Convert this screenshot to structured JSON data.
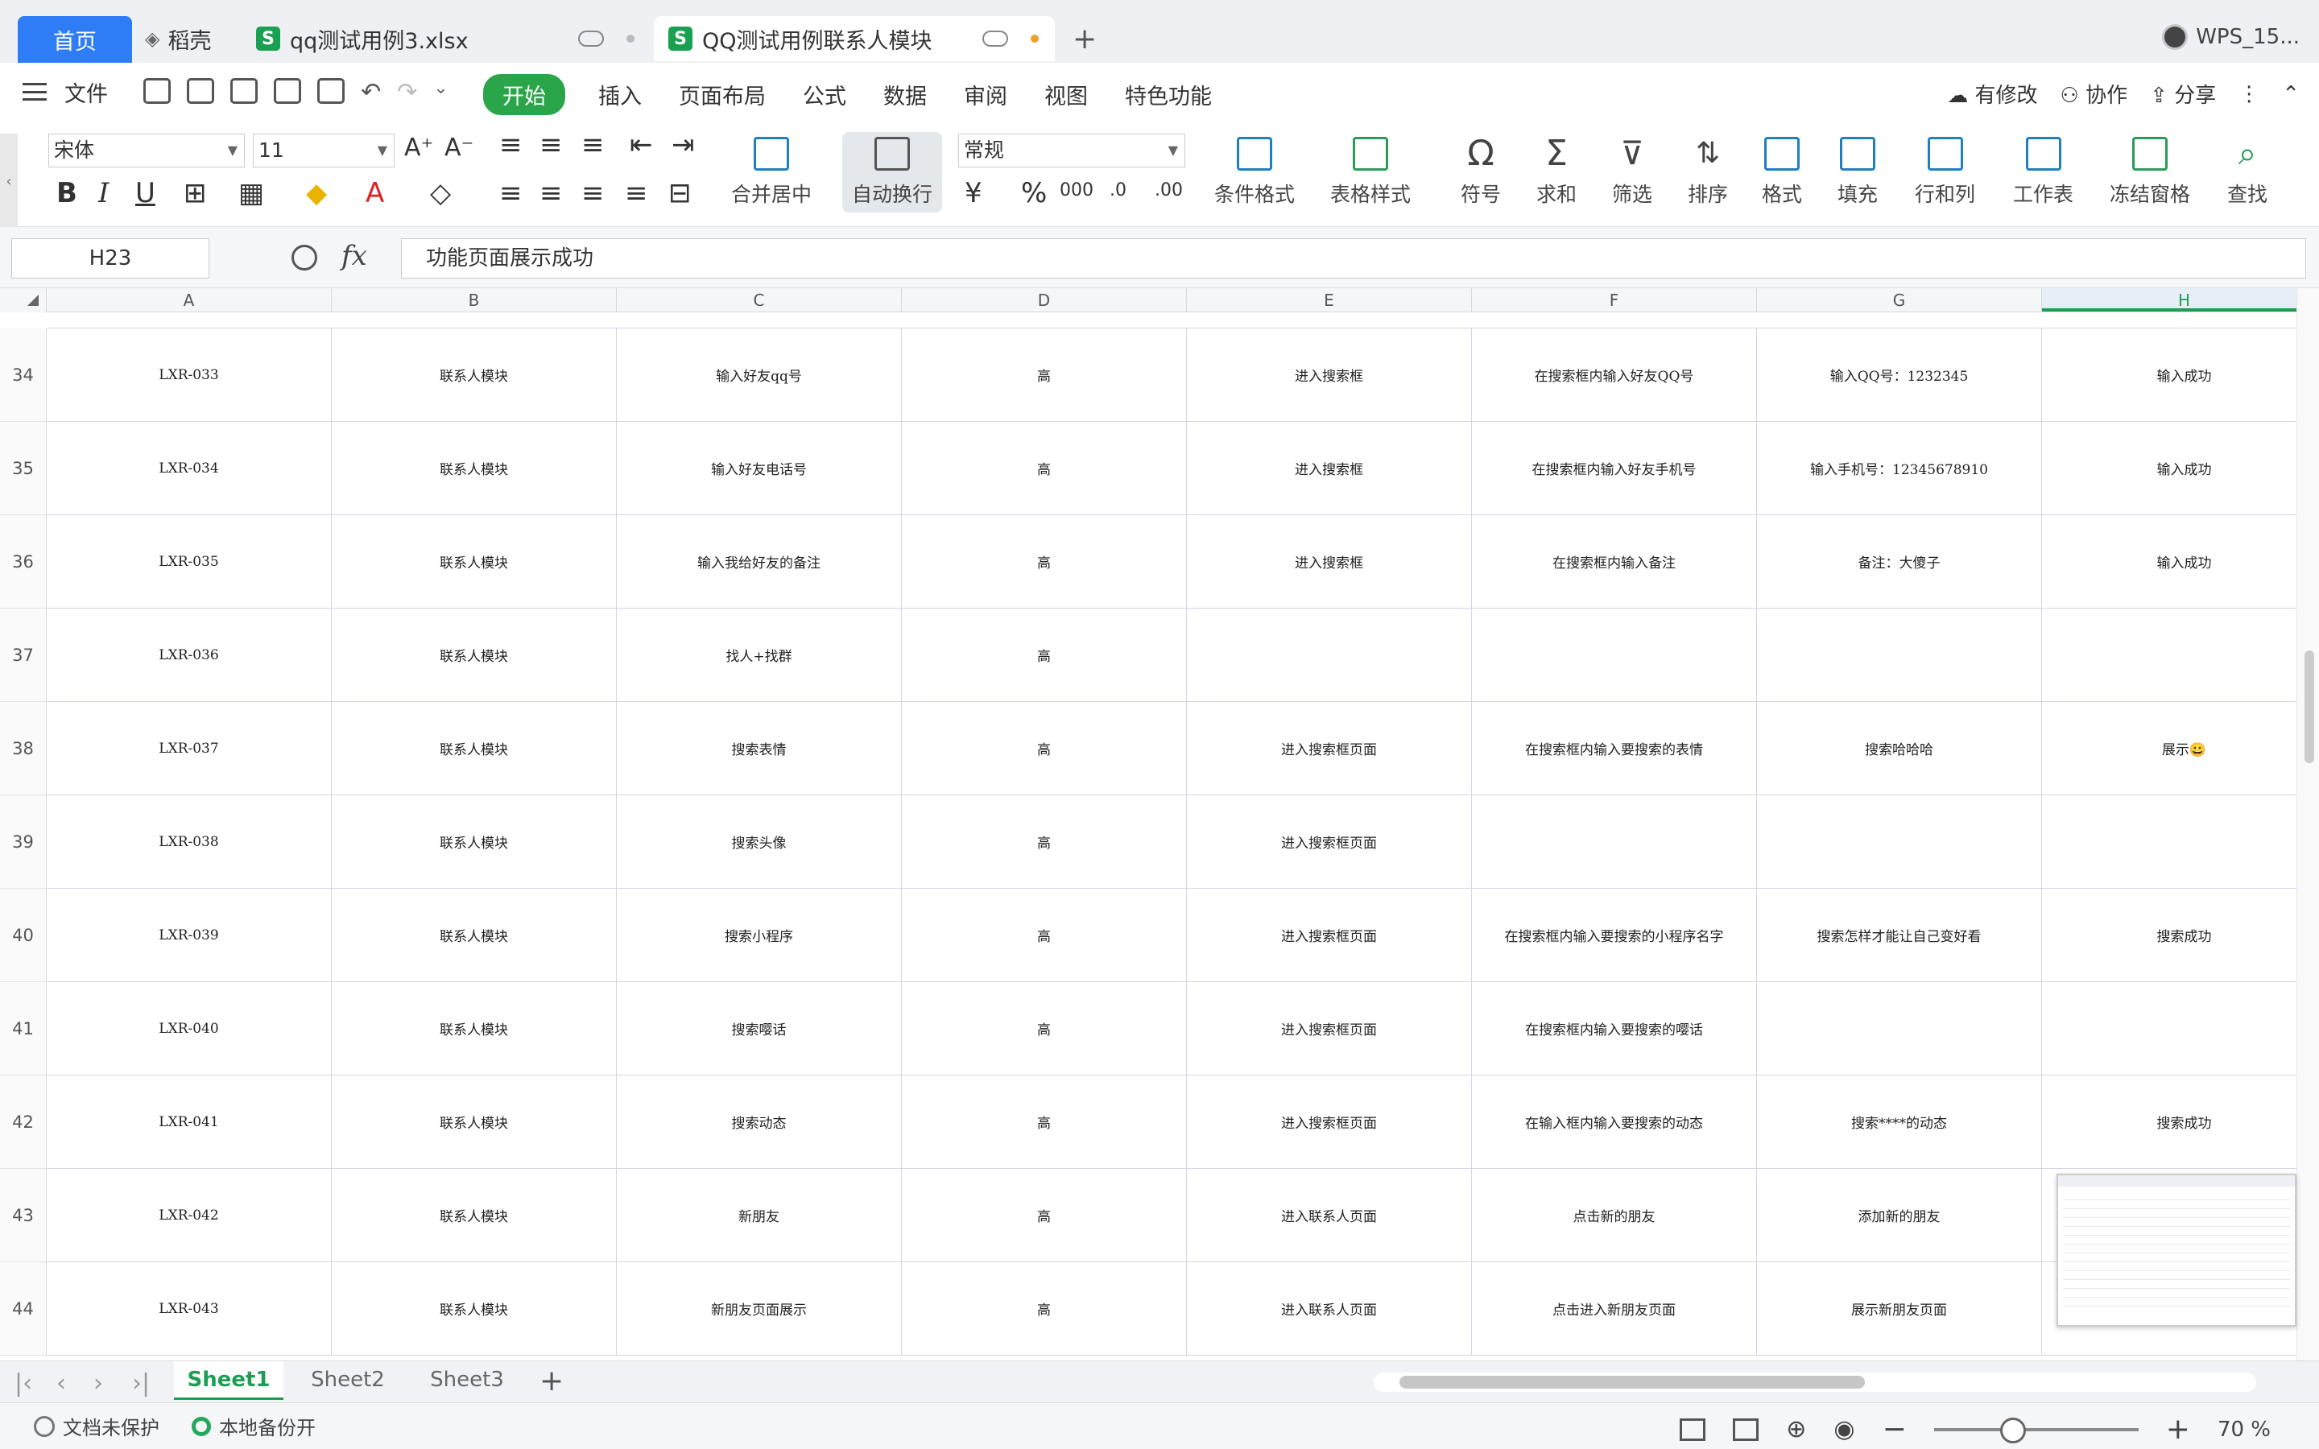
{
  "tabs": {
    "home": "首页",
    "daoke": "稻壳",
    "file1": "qq测试用例3.xlsx",
    "file2": "QQ测试用例联系人模块",
    "user": "WPS_15..."
  },
  "menu": {
    "file": "文件",
    "items": [
      "开始",
      "插入",
      "页面布局",
      "公式",
      "数据",
      "审阅",
      "视图",
      "特色功能"
    ],
    "modified": "有修改",
    "collab": "协作",
    "share": "分享"
  },
  "ribbon": {
    "font": "宋体",
    "size": "11",
    "merge": "合并居中",
    "wrap": "自动换行",
    "numfmt": "常规",
    "cond": "条件格式",
    "tablestyle": "表格样式",
    "symbol": "符号",
    "sum": "求和",
    "filter": "筛选",
    "sort": "排序",
    "format": "格式",
    "fill": "填充",
    "rowcol": "行和列",
    "sheet": "工作表",
    "freeze": "冻结窗格",
    "find": "查找"
  },
  "formulabar": {
    "cell": "H23",
    "content": "功能页面展示成功"
  },
  "columns": [
    "A",
    "B",
    "C",
    "D",
    "E",
    "F",
    "G",
    "H"
  ],
  "rows": [
    {
      "n": "34",
      "c": [
        "LXR-033",
        "联系人模块",
        "输入好友qq号",
        "高",
        "进入搜索框",
        "在搜索框内输入好友QQ号",
        "输入QQ号：1232345",
        "输入成功"
      ]
    },
    {
      "n": "35",
      "c": [
        "LXR-034",
        "联系人模块",
        "输入好友电话号",
        "高",
        "进入搜索框",
        "在搜索框内输入好友手机号",
        "输入手机号：12345678910",
        "输入成功"
      ]
    },
    {
      "n": "36",
      "c": [
        "LXR-035",
        "联系人模块",
        "输入我给好友的备注",
        "高",
        "进入搜索框",
        "在搜索框内输入备注",
        "备注：大傻子",
        "输入成功"
      ]
    },
    {
      "n": "37",
      "c": [
        "LXR-036",
        "联系人模块",
        "找人+找群",
        "高",
        "",
        "",
        "",
        ""
      ]
    },
    {
      "n": "38",
      "c": [
        "LXR-037",
        "联系人模块",
        "搜索表情",
        "高",
        "进入搜索框页面",
        "在搜索框内输入要搜索的表情",
        "搜索哈哈哈",
        "展示😀"
      ]
    },
    {
      "n": "39",
      "c": [
        "LXR-038",
        "联系人模块",
        "搜索头像",
        "高",
        "进入搜索框页面",
        "",
        "",
        ""
      ]
    },
    {
      "n": "40",
      "c": [
        "LXR-039",
        "联系人模块",
        "搜索小程序",
        "高",
        "进入搜索框页面",
        "在搜索框内输入要搜索的小程序名字",
        "搜索怎样才能让自己变好看",
        "搜索成功"
      ]
    },
    {
      "n": "41",
      "c": [
        "LXR-040",
        "联系人模块",
        "搜索嘤话",
        "高",
        "进入搜索框页面",
        "在搜索框内输入要搜索的嘤话",
        "",
        ""
      ]
    },
    {
      "n": "42",
      "c": [
        "LXR-041",
        "联系人模块",
        "搜索动态",
        "高",
        "进入搜索框页面",
        "在输入框内输入要搜索的动态",
        "搜索****的动态",
        "搜索成功"
      ]
    },
    {
      "n": "43",
      "c": [
        "LXR-042",
        "联系人模块",
        "新朋友",
        "高",
        "进入联系人页面",
        "点击新的朋友",
        "添加新的朋友",
        ""
      ]
    },
    {
      "n": "44",
      "c": [
        "LXR-043",
        "联系人模块",
        "新朋友页面展示",
        "高",
        "进入联系人页面",
        "点击进入新朋友页面",
        "展示新朋友页面",
        ""
      ]
    }
  ],
  "sheets": [
    "Sheet1",
    "Sheet2",
    "Sheet3"
  ],
  "status": {
    "protect": "文档未保护",
    "backup": "本地备份开",
    "zoom": "70 %"
  }
}
